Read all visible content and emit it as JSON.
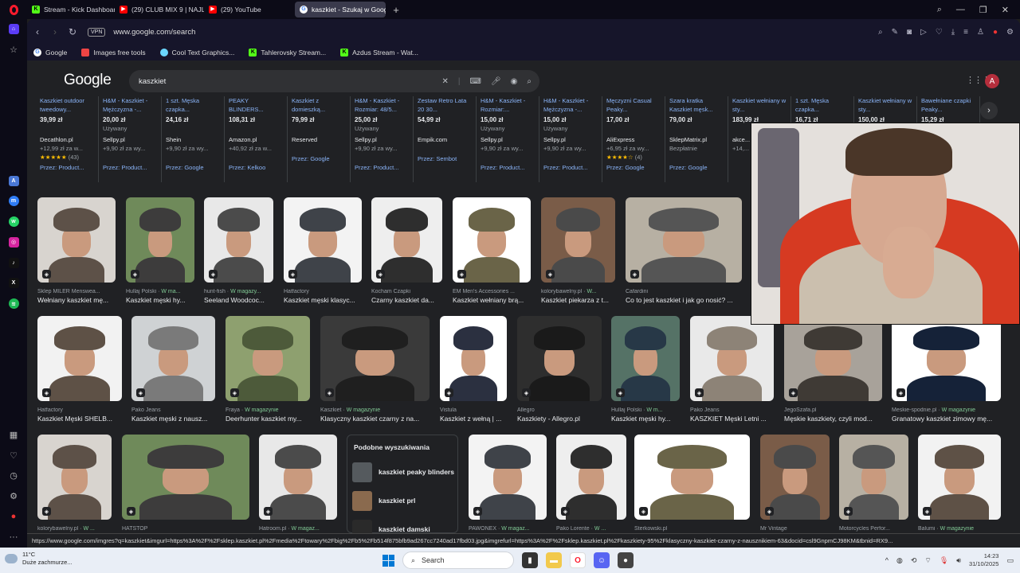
{
  "tabs": [
    {
      "label": "Stream - Kick Dashboard",
      "icon": "kick-icon"
    },
    {
      "label": "(29) CLUB MIX 9 | NAJLEP",
      "icon": "youtube-icon"
    },
    {
      "label": "(29) YouTube",
      "icon": "youtube-icon"
    },
    {
      "label": "kaszkiet - Szukaj w Googl",
      "icon": "google-icon",
      "active": true
    }
  ],
  "address": {
    "vpn": "VPN",
    "url": "www.google.com/search"
  },
  "bookmarks": [
    {
      "label": "Google"
    },
    {
      "label": "Images free tools"
    },
    {
      "label": "Cool Text Graphics..."
    },
    {
      "label": "Tahlerovsky Stream..."
    },
    {
      "label": "Azdus Stream - Wat..."
    }
  ],
  "google": {
    "logo": "Google",
    "query": "kaszkiet",
    "avatar": "A"
  },
  "products": [
    {
      "title": "Kaszkiet outdoor tweedowy...",
      "price": "39,99 zł",
      "used": "",
      "store": "Decathlon.pl",
      "ship": "+12,99 zł za w...",
      "rating": "★★★★★",
      "reviews": "(43)",
      "by": "Przez: Product..."
    },
    {
      "title": "H&M - Kaszkiet - Mężczyzna -...",
      "price": "20,00 zł",
      "used": "Używany",
      "store": "Sellpy.pl",
      "ship": "+9,90 zł za wy...",
      "rating": "",
      "reviews": "",
      "by": "Przez: Product..."
    },
    {
      "title": "1 szt. Męska czapka...",
      "price": "24,16 zł",
      "used": "",
      "store": "Shein",
      "ship": "+9,90 zł za wy...",
      "rating": "",
      "reviews": "",
      "by": "Przez: Google"
    },
    {
      "title": "PEAKY BLINDERS...",
      "price": "108,31 zł",
      "used": "",
      "store": "Amazon.pl",
      "ship": "+40,92 zł za w...",
      "rating": "",
      "reviews": "",
      "by": "Przez: Kelkoo"
    },
    {
      "title": "Kaszkiet z domieszką...",
      "price": "79,99 zł",
      "used": "",
      "store": "Reserved",
      "ship": "",
      "rating": "",
      "reviews": "",
      "by": "Przez: Google"
    },
    {
      "title": "H&M - Kaszkiet - Rozmiar: 48/5...",
      "price": "25,00 zł",
      "used": "Używany",
      "store": "Sellpy.pl",
      "ship": "+9,90 zł za wy...",
      "rating": "",
      "reviews": "",
      "by": "Przez: Product..."
    },
    {
      "title": "Zestaw Retro Lata 20 30...",
      "price": "54,99 zł",
      "used": "",
      "store": "Empik.com",
      "ship": "",
      "rating": "",
      "reviews": "",
      "by": "Przez: Sembot"
    },
    {
      "title": "H&M - Kaszkiet - Rozmiar:...",
      "price": "15,00 zł",
      "used": "Używany",
      "store": "Sellpy.pl",
      "ship": "+9,90 zł za wy...",
      "rating": "",
      "reviews": "",
      "by": "Przez: Product..."
    },
    {
      "title": "H&M - Kaszkiet - Mężczyzna -...",
      "price": "15,00 zł",
      "used": "Używany",
      "store": "Sellpy.pl",
      "ship": "+9,90 zł za wy...",
      "rating": "",
      "reviews": "",
      "by": "Przez: Product..."
    },
    {
      "title": "Męczyzni Casual Peaky...",
      "price": "17,00 zł",
      "used": "",
      "store": "AliExpress",
      "ship": "+6,95 zł za wy...",
      "rating": "★★★★☆",
      "reviews": "(4)",
      "by": "Przez: Google"
    },
    {
      "title": "Szara kratka Kaszkiet męsk...",
      "price": "79,00 zł",
      "used": "",
      "store": "SklepMatrix.pl",
      "ship": "Bezpłatnie",
      "rating": "",
      "reviews": "",
      "by": "Przez: Google"
    },
    {
      "title": "Kaszkiet wełniany w sty...",
      "price": "183,99 zł",
      "used": "",
      "store": "akce...",
      "ship": "+14,...",
      "rating": "",
      "reviews": "",
      "by": ""
    },
    {
      "title": "1 szt. Męska czapka...",
      "price": "16,71 zł",
      "used": "",
      "store": "",
      "ship": "",
      "rating": "",
      "reviews": "",
      "by": ""
    },
    {
      "title": "Kaszkiet wełniany w sty...",
      "price": "150,00 zł",
      "used": "",
      "store": "",
      "ship": "",
      "rating": "",
      "reviews": "",
      "by": ""
    },
    {
      "title": "Bawełniane czapki Peaky...",
      "price": "15,29 zł",
      "used": "",
      "store": "",
      "ship": "",
      "rating": "",
      "reviews": "",
      "by": ""
    }
  ],
  "row1": [
    {
      "src": "Sklep MILER Menswea...",
      "w": "",
      "title": "Wełniany kaszkiet mę..."
    },
    {
      "src": "Hullaj Polski · ",
      "w": "W ma...",
      "title": "Kaszkiet męski hy..."
    },
    {
      "src": "hunt-fish · ",
      "w": "W magazy...",
      "title": "Seeland Woodcoc..."
    },
    {
      "src": "Hatfactory",
      "w": "",
      "title": "Kaszkiet męski klasyc..."
    },
    {
      "src": "Kocham Czapki",
      "w": "",
      "title": "Czarny kaszkiet da..."
    },
    {
      "src": "EM Men's Accessories ...",
      "w": "",
      "title": "Kaszkiet wełniany brą..."
    },
    {
      "src": "kolorybawelny.pl · ",
      "w": "W...",
      "title": "Kaszkiet piekarza z t..."
    },
    {
      "src": "Cafardini",
      "w": "",
      "title": "Co to jest kaszkiet i jak go nosić? ..."
    }
  ],
  "row2": [
    {
      "src": "Hatfactory",
      "w": "",
      "title": "Kaszkiet Męski SHELB..."
    },
    {
      "src": "Pako Jeans",
      "w": "",
      "title": "Kaszkiet męski z nausz..."
    },
    {
      "src": "Fraya · ",
      "w": "W magazynie",
      "title": "Deerhunter kaszkiet my..."
    },
    {
      "src": "Kaszkiet · ",
      "w": "W magazynie",
      "title": "Klasyczny kaszkiet czarny z na..."
    },
    {
      "src": "Vistula",
      "w": "",
      "title": "Kaszkiet z wełną | ..."
    },
    {
      "src": "Allegro",
      "w": "",
      "title": "Kaszkiety - Allegro.pl"
    },
    {
      "src": "Hullaj Polski · ",
      "w": "W m...",
      "title": "Kaszkiet męski hy..."
    },
    {
      "src": "Pako Jeans",
      "w": "",
      "title": "KASZKIET Męski Letni ..."
    },
    {
      "src": "JegoSzafa.pl",
      "w": "",
      "title": "Męskie kaszkiety, czyli mod..."
    },
    {
      "src": "Meskie-spodnie.pl · ",
      "w": "W magazynie",
      "title": "Granatowy kaszkiet zimowy mę..."
    }
  ],
  "row3": [
    {
      "src": "kolorybawelny.pl · ",
      "w": "W ...",
      "title": ""
    },
    {
      "src": "HATSTOP",
      "w": "",
      "title": ""
    },
    {
      "src": "Hatroom.pl · ",
      "w": "W magaz...",
      "title": ""
    },
    {
      "src": "PAWONEX · ",
      "w": "W magaz...",
      "title": ""
    },
    {
      "src": "Pako Lorente · ",
      "w": "W ...",
      "title": ""
    },
    {
      "src": "Sterkowski.pl",
      "w": "",
      "title": ""
    },
    {
      "src": "Mr Vintage",
      "w": "",
      "title": ""
    },
    {
      "src": "Motorcycles Perfor...",
      "w": "",
      "title": ""
    },
    {
      "src": "Balumi · ",
      "w": "W magazynie",
      "title": ""
    }
  ],
  "related": {
    "heading": "Podobne wyszukiwania",
    "items": [
      "kaszkiet peaky blinders",
      "kaszkiet prl",
      "kaszkiet damski"
    ]
  },
  "status_url": "https://www.google.com/imgres?q=kaszkiet&imgurl=https%3A%2F%2Fsklep.kaszkiet.pl%2Fmedia%2Ftowary%2Fbig%2Fb5%2Fb514f875bfb9ad267cc7240ad17fbd03.jpg&imgrefurl=https%3A%2F%2Fsklep.kaszkiet.pl%2Fkaszkiety-95%2Fklasyczny-kaszkiet-czarny-z-nausznikiem-63&docid=csl9GnpmCJ98KM&tbnid=RX9...",
  "taskbar": {
    "temp": "11°C",
    "weather": "Duże zachmurze...",
    "search": "Search",
    "time": "14:23",
    "date": "31/10/2025"
  },
  "colors": {
    "accent": "#8ab4f8",
    "opera": "#ff1b2d",
    "kick": "#53fc18",
    "in_stock": "#81c995"
  }
}
